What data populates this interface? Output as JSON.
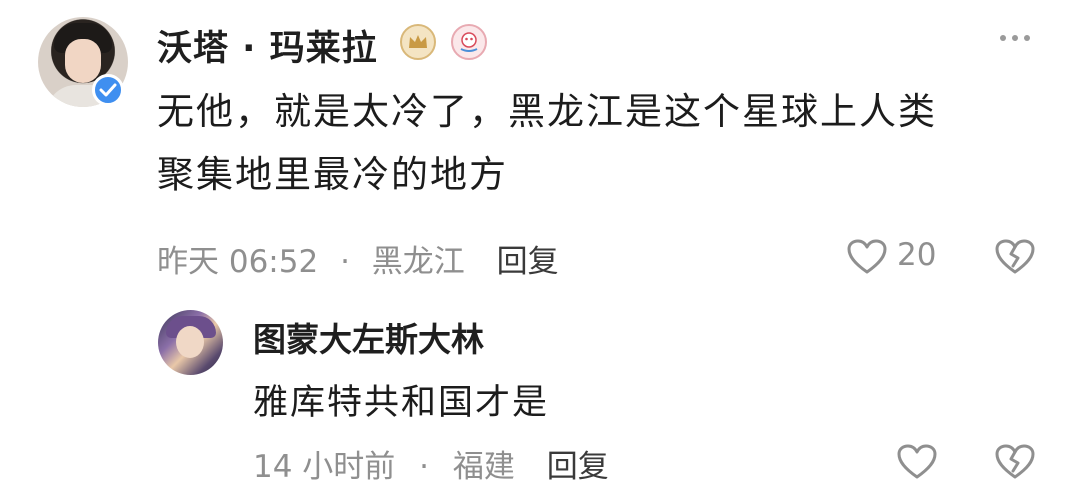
{
  "comment": {
    "username": "沃塔 · 玛莱拉",
    "badges": [
      "crown-badge-icon",
      "fan-badge-icon"
    ],
    "verified": true,
    "text_line1": "无他，就是太冷了，黑龙江是这个星球上人类",
    "text_line2": "聚集地里最冷的地方",
    "time": "昨天 06:52",
    "separator": "·",
    "location": "黑龙江",
    "reply_label": "回复",
    "like_count": "20"
  },
  "reply": {
    "username": "图蒙大左斯大林",
    "text": "雅库特共和国才是",
    "time": "14 小时前",
    "separator": "·",
    "location": "福建",
    "reply_label": "回复"
  },
  "colors": {
    "verify_blue": "#3f8ff0",
    "meta_gray": "#8f8f8f",
    "crown_gold": "#d9b879"
  }
}
